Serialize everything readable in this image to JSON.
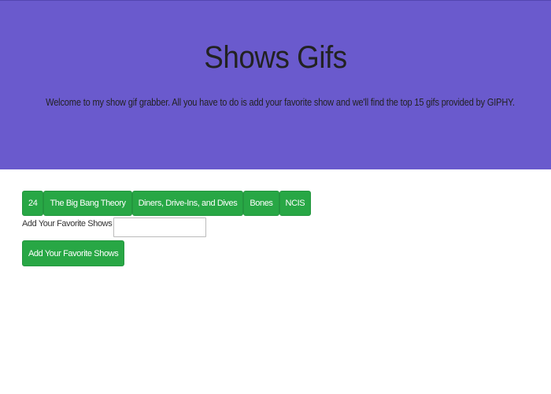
{
  "hero": {
    "title": "Shows Gifs",
    "description": "Welcome to my show gif grabber. All you have to do is add your favorite show and we'll find the top 15 gifs provided by GIPHY."
  },
  "shows": [
    {
      "label": "24"
    },
    {
      "label": "The Big Bang Theory"
    },
    {
      "label": "Diners, Drive-Ins, and Dives"
    },
    {
      "label": "Bones"
    },
    {
      "label": "NCIS"
    }
  ],
  "form": {
    "label": "Add Your Favorite Shows",
    "input_value": "",
    "submit_label": "Add Your Favorite Shows"
  },
  "colors": {
    "hero_background": "#6a5acd",
    "button_green": "#28a745",
    "button_text": "#ffffff"
  }
}
